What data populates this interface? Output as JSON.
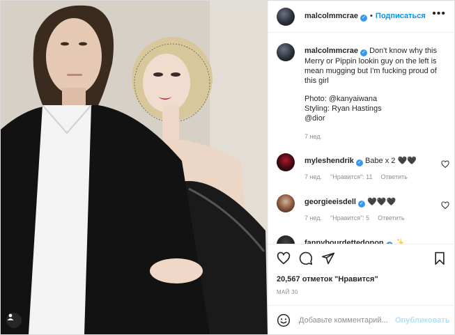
{
  "post": {
    "photo_alt": "",
    "author": "malcolmmcrae",
    "follow_label": "Подписаться",
    "more_label": "•••"
  },
  "caption": {
    "username": "malcolmmcrae",
    "text": "Don't know why this Merry or Pippin lookin guy on the left is mean mugging but I'm fucking proud of this girl",
    "photo_credit": "Photo: @kanyaiwana",
    "styling_credit": "Styling: Ryan Hastings",
    "brand": "@dior",
    "time": "7 нед."
  },
  "comments": [
    {
      "username": "myleshendrik",
      "text": "Babe x 2 🖤🖤",
      "time": "7 нед.",
      "likes": "\"Нравится\": 11",
      "reply": "Ответить"
    },
    {
      "username": "georgieeisdell",
      "text": "🖤🖤🖤",
      "time": "7 нед.",
      "likes": "\"Нравится\": 5",
      "reply": "Ответить"
    },
    {
      "username": "fannybourdettedonon",
      "text": "✨"
    }
  ],
  "actions": {
    "likes_text": "20,567 отметок \"Нравится\"",
    "date": "МАЙ 30"
  },
  "add_comment": {
    "placeholder": "Добавьте комментарий...",
    "post_label": "Опубликовать"
  },
  "colors": {
    "accent": "#0095f6",
    "verified": "#3897f0",
    "muted": "#8e8e8e",
    "post_disabled": "#b2dffc"
  },
  "icons": [
    "more-options-icon",
    "verified-badge-icon",
    "heart-icon",
    "comment-icon",
    "share-icon",
    "bookmark-icon",
    "emoji-icon",
    "tag-person-icon"
  ]
}
